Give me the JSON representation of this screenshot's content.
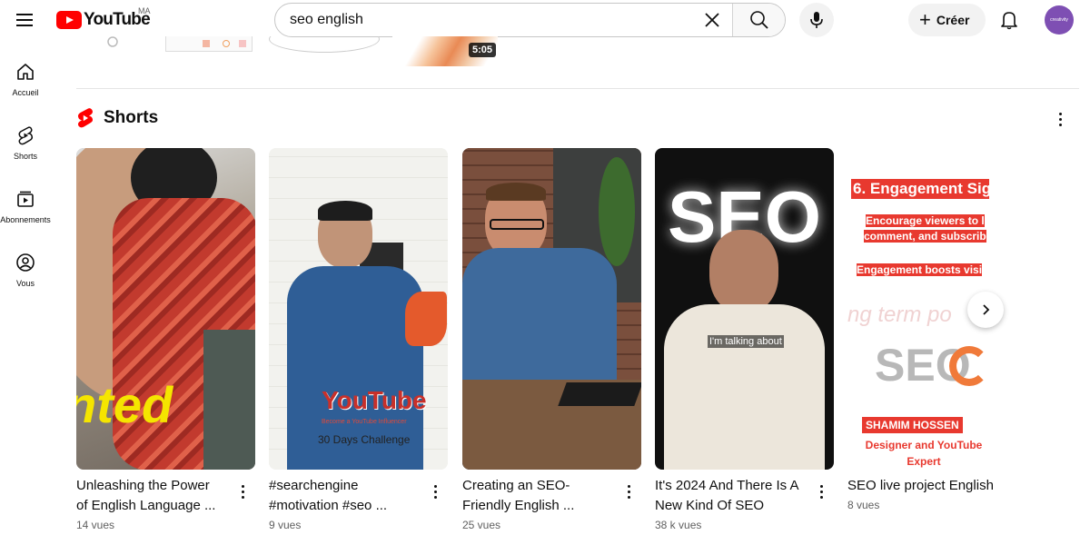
{
  "header": {
    "logo_text": "YouTube",
    "region": "MA",
    "search_value": "seo english",
    "create_label": "Créer",
    "avatar_text": "creativity"
  },
  "sidebar": {
    "items": [
      {
        "label": "Accueil",
        "icon": "home-icon"
      },
      {
        "label": "Shorts",
        "icon": "shorts-icon"
      },
      {
        "label": "Abonnements",
        "icon": "subscriptions-icon"
      },
      {
        "label": "Vous",
        "icon": "you-icon"
      }
    ]
  },
  "previous_row": {
    "duration": "5:05"
  },
  "shorts": {
    "title": "Shorts",
    "items": [
      {
        "title": "Unleashing the Power of English Language ...",
        "views": "14 vues",
        "overlay": "nted"
      },
      {
        "title": "#searchengine #motivation #seo ...",
        "views": "9 vues",
        "overlay": "YouTube",
        "overlay_sub": "Become a YouTube Influencer",
        "overlay_sub2": "30 Days Challenge"
      },
      {
        "title": "Creating an SEO-Friendly English ...",
        "views": "25 vues"
      },
      {
        "title": "It's 2024 And There Is A New Kind Of SEO",
        "views": "38 k vues",
        "overlay": "SEO",
        "caption": "I'm talking about"
      },
      {
        "title": "SEO live project English",
        "views": "8 vues",
        "overlay": "6. Engagement Sig",
        "lines": [
          "Encourage viewers to l",
          "comment, and subscrib",
          "Engagement boosts visi"
        ],
        "ghost": "ng term po",
        "logo": "SEO",
        "badge": "SHAMIM HOSSEN",
        "role": "Designer and YouTube Expert"
      }
    ]
  },
  "colors": {
    "brand_red": "#ff0000",
    "avatar": "#7e4fb3"
  }
}
